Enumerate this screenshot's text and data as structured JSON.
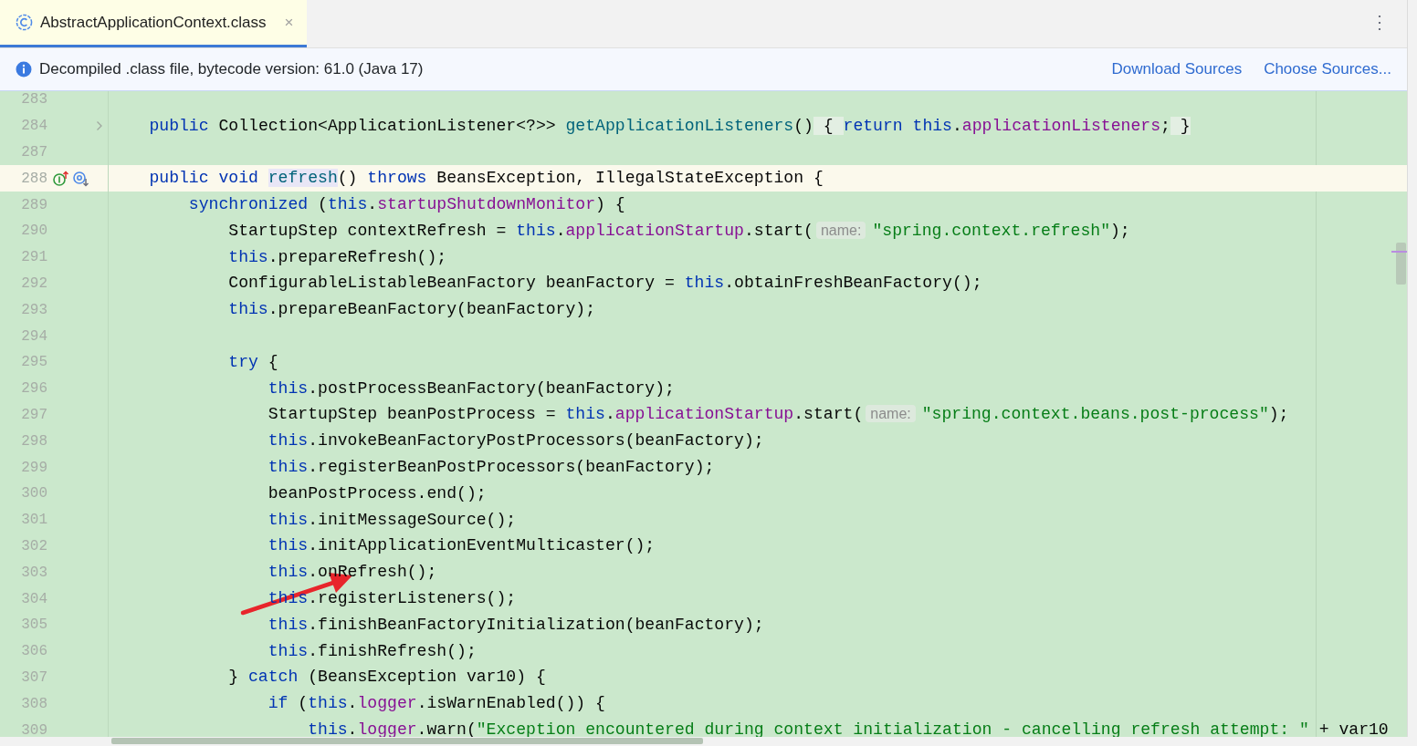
{
  "tabs": [
    {
      "label": "AbstractApplicationContext.class",
      "selected": true,
      "close": "×"
    }
  ],
  "menu": "⋮",
  "banner": {
    "message": "Decompiled .class file, bytecode version: 61.0 (Java 17)",
    "links": [
      "Download Sources",
      "Choose Sources..."
    ]
  },
  "editor": {
    "lines": [
      {
        "number": "283",
        "current": false,
        "folded": false
      },
      {
        "number": "284",
        "current": false,
        "folded": true,
        "tokens": [
          {
            "t": "    public",
            "kind": "kw"
          },
          {
            "t": " Collection<ApplicationListener<?>> ",
            "kind": "plain"
          },
          {
            "t": "getApplicationListeners",
            "kind": "method"
          },
          {
            "t": "()",
            "kind": "plain"
          },
          {
            "t": " { ",
            "kind": "fold"
          },
          {
            "t": "return ",
            "kind": "kw"
          },
          {
            "t": "this",
            "kind": "kw"
          },
          {
            "t": ".",
            "kind": "plain"
          },
          {
            "t": "applicationListeners",
            "kind": "field"
          },
          {
            "t": ";",
            "kind": "plain"
          },
          {
            "t": " }",
            "kind": "fold"
          }
        ]
      },
      {
        "number": "287",
        "current": false,
        "folded": false
      },
      {
        "number": "288",
        "current": true,
        "folded": false,
        "gutter_icons": [
          {
            "kind": "implements"
          },
          {
            "kind": "overridden"
          }
        ],
        "tokens": [
          {
            "t": "    public void ",
            "kind": "kw"
          },
          {
            "t": "refresh",
            "kind": "decl"
          },
          {
            "t": "() ",
            "kind": "plain"
          },
          {
            "t": "throws",
            "kind": "kw"
          },
          {
            "t": " BeansException, IllegalStateException {",
            "kind": "plain"
          }
        ]
      },
      {
        "number": "289",
        "current": false,
        "folded": false,
        "tokens": [
          {
            "t": "        synchronized",
            "kind": "kw"
          },
          {
            "t": " (",
            "kind": "plain"
          },
          {
            "t": "this",
            "kind": "kw"
          },
          {
            "t": ".",
            "kind": "plain"
          },
          {
            "t": "startupShutdownMonitor",
            "kind": "field"
          },
          {
            "t": ") {",
            "kind": "plain"
          }
        ]
      },
      {
        "number": "290",
        "current": false,
        "folded": false,
        "tokens": [
          {
            "t": "            StartupStep contextRefresh = ",
            "kind": "plain"
          },
          {
            "t": "this",
            "kind": "kw"
          },
          {
            "t": ".",
            "kind": "plain"
          },
          {
            "t": "applicationStartup",
            "kind": "field"
          },
          {
            "t": ".start(",
            "kind": "plain"
          },
          {
            "t": "name:",
            "kind": "hint"
          },
          {
            "t": "\"spring.context.refresh\"",
            "kind": "str"
          },
          {
            "t": ");",
            "kind": "plain"
          }
        ]
      },
      {
        "number": "291",
        "current": false,
        "folded": false,
        "tokens": [
          {
            "t": "            this",
            "kind": "kw"
          },
          {
            "t": ".prepareRefresh();",
            "kind": "plain"
          }
        ]
      },
      {
        "number": "292",
        "current": false,
        "folded": false,
        "tokens": [
          {
            "t": "            ConfigurableListableBeanFactory beanFactory = ",
            "kind": "plain"
          },
          {
            "t": "this",
            "kind": "kw"
          },
          {
            "t": ".obtainFreshBeanFactory();",
            "kind": "plain"
          }
        ]
      },
      {
        "number": "293",
        "current": false,
        "folded": false,
        "tokens": [
          {
            "t": "            this",
            "kind": "kw"
          },
          {
            "t": ".prepareBeanFactory(beanFactory);",
            "kind": "plain"
          }
        ]
      },
      {
        "number": "294",
        "current": false,
        "folded": false
      },
      {
        "number": "295",
        "current": false,
        "folded": false,
        "tokens": [
          {
            "t": "            try",
            "kind": "kw"
          },
          {
            "t": " {",
            "kind": "plain"
          }
        ]
      },
      {
        "number": "296",
        "current": false,
        "folded": false,
        "tokens": [
          {
            "t": "                this",
            "kind": "kw"
          },
          {
            "t": ".postProcessBeanFactory(beanFactory);",
            "kind": "plain"
          }
        ]
      },
      {
        "number": "297",
        "current": false,
        "folded": false,
        "tokens": [
          {
            "t": "                StartupStep beanPostProcess = ",
            "kind": "plain"
          },
          {
            "t": "this",
            "kind": "kw"
          },
          {
            "t": ".",
            "kind": "plain"
          },
          {
            "t": "applicationStartup",
            "kind": "field"
          },
          {
            "t": ".start(",
            "kind": "plain"
          },
          {
            "t": "name:",
            "kind": "hint"
          },
          {
            "t": "\"spring.context.beans.post-process\"",
            "kind": "str"
          },
          {
            "t": ");",
            "kind": "plain"
          }
        ]
      },
      {
        "number": "298",
        "current": false,
        "folded": false,
        "tokens": [
          {
            "t": "                this",
            "kind": "kw"
          },
          {
            "t": ".invokeBeanFactoryPostProcessors(beanFactory);",
            "kind": "plain"
          }
        ]
      },
      {
        "number": "299",
        "current": false,
        "folded": false,
        "tokens": [
          {
            "t": "                this",
            "kind": "kw"
          },
          {
            "t": ".registerBeanPostProcessors(beanFactory);",
            "kind": "plain"
          }
        ]
      },
      {
        "number": "300",
        "current": false,
        "folded": false,
        "tokens": [
          {
            "t": "                beanPostProcess.end();",
            "kind": "plain"
          }
        ]
      },
      {
        "number": "301",
        "current": false,
        "folded": false,
        "tokens": [
          {
            "t": "                this",
            "kind": "kw"
          },
          {
            "t": ".initMessageSource();",
            "kind": "plain"
          }
        ]
      },
      {
        "number": "302",
        "current": false,
        "folded": false,
        "tokens": [
          {
            "t": "                this",
            "kind": "kw"
          },
          {
            "t": ".initApplicationEventMulticaster();",
            "kind": "plain"
          }
        ]
      },
      {
        "number": "303",
        "current": false,
        "folded": false,
        "tokens": [
          {
            "t": "                this",
            "kind": "kw"
          },
          {
            "t": ".onRefresh();",
            "kind": "plain"
          }
        ]
      },
      {
        "number": "304",
        "current": false,
        "folded": false,
        "tokens": [
          {
            "t": "                this",
            "kind": "kw"
          },
          {
            "t": ".registerListeners();",
            "kind": "plain"
          }
        ]
      },
      {
        "number": "305",
        "current": false,
        "folded": false,
        "tokens": [
          {
            "t": "                this",
            "kind": "kw"
          },
          {
            "t": ".finishBeanFactoryInitialization(beanFactory);",
            "kind": "plain"
          }
        ]
      },
      {
        "number": "306",
        "current": false,
        "folded": false,
        "tokens": [
          {
            "t": "                this",
            "kind": "kw"
          },
          {
            "t": ".finishRefresh();",
            "kind": "plain"
          }
        ]
      },
      {
        "number": "307",
        "current": false,
        "folded": false,
        "tokens": [
          {
            "t": "            } ",
            "kind": "plain"
          },
          {
            "t": "catch",
            "kind": "kw"
          },
          {
            "t": " (BeansException var10) {",
            "kind": "plain"
          }
        ]
      },
      {
        "number": "308",
        "current": false,
        "folded": false,
        "tokens": [
          {
            "t": "                if",
            "kind": "kw"
          },
          {
            "t": " (",
            "kind": "plain"
          },
          {
            "t": "this",
            "kind": "kw"
          },
          {
            "t": ".",
            "kind": "plain"
          },
          {
            "t": "logger",
            "kind": "field"
          },
          {
            "t": ".isWarnEnabled()) {",
            "kind": "plain"
          }
        ]
      },
      {
        "number": "309",
        "current": false,
        "folded": false,
        "tokens": [
          {
            "t": "                    this",
            "kind": "kw"
          },
          {
            "t": ".",
            "kind": "plain"
          },
          {
            "t": "logger",
            "kind": "field"
          },
          {
            "t": ".warn(",
            "kind": "plain"
          },
          {
            "t": "\"Exception encountered during context initialization - cancelling refresh attempt: \"",
            "kind": "str"
          },
          {
            "t": " + var10",
            "kind": "plain"
          }
        ]
      }
    ]
  }
}
